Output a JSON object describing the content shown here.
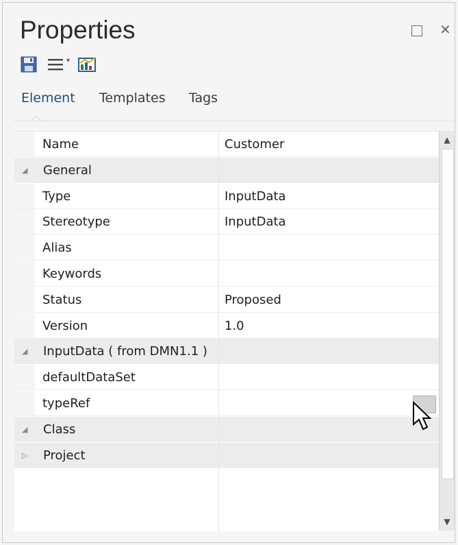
{
  "window": {
    "title": "Properties",
    "maximize_label": "□",
    "close_label": "✕"
  },
  "toolbar": {
    "save_icon": "save-icon",
    "menu_icon": "menu-icon",
    "menu_caret": "▾",
    "chart_icon": "chart-icon"
  },
  "tabs": [
    {
      "label": "Element",
      "active": true
    },
    {
      "label": "Templates",
      "active": false
    },
    {
      "label": "Tags",
      "active": false
    }
  ],
  "grid": {
    "rows": [
      {
        "kind": "prop",
        "name": "Name",
        "value": "Customer"
      },
      {
        "kind": "cat",
        "name": "General",
        "expanded": true,
        "glyph": "◢"
      },
      {
        "kind": "prop",
        "name": "Type",
        "value": "InputData"
      },
      {
        "kind": "prop",
        "name": "Stereotype",
        "value": "InputData"
      },
      {
        "kind": "prop",
        "name": "Alias",
        "value": ""
      },
      {
        "kind": "prop",
        "name": "Keywords",
        "value": ""
      },
      {
        "kind": "prop",
        "name": "Status",
        "value": "Proposed"
      },
      {
        "kind": "prop",
        "name": "Version",
        "value": "1.0"
      },
      {
        "kind": "cat",
        "name": "InputData ( from DMN1.1 )",
        "expanded": true,
        "glyph": "◢"
      },
      {
        "kind": "prop",
        "name": "defaultDataSet",
        "value": ""
      },
      {
        "kind": "prop",
        "name": "typeRef",
        "value": "",
        "has_button": true
      },
      {
        "kind": "cat",
        "name": "Class",
        "expanded": true,
        "glyph": "◢"
      },
      {
        "kind": "cat",
        "name": "Project",
        "expanded": false,
        "glyph": "▷"
      }
    ]
  },
  "scrollbar": {
    "up": "▲",
    "down": "▼"
  },
  "colors": {
    "accent": "#1a4f7a",
    "category_bg": "#ececec",
    "button_bg": "#d4d4d4"
  }
}
